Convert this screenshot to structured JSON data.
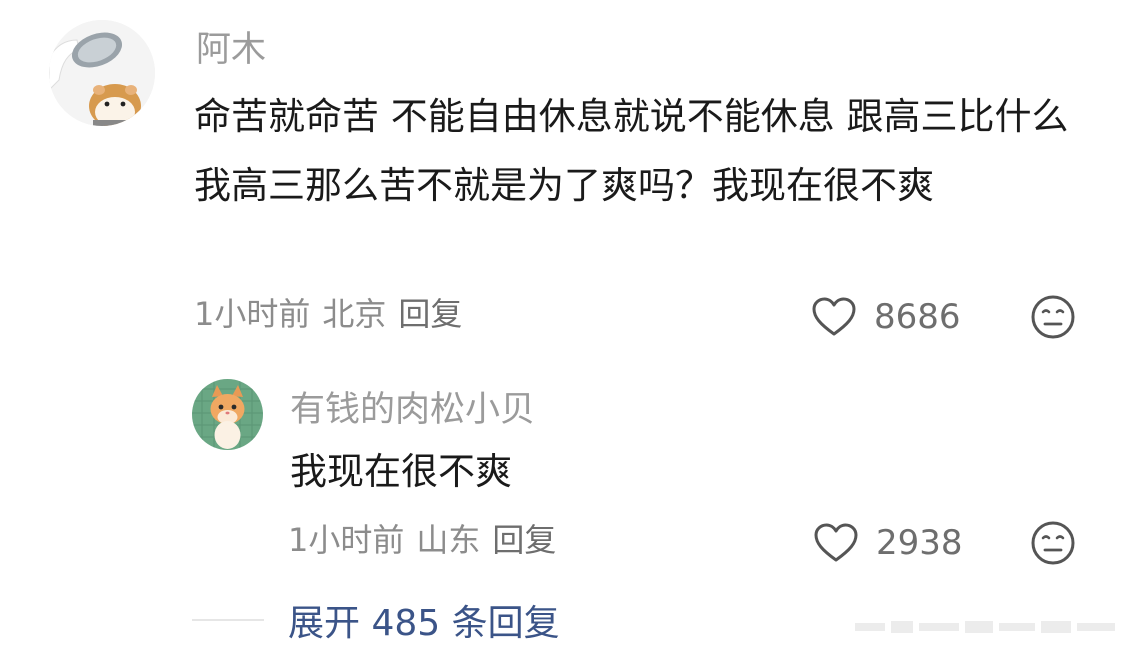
{
  "comment": {
    "author": "阿木",
    "text": "命苦就命苦 不能自由休息就说不能休息 跟高三比什么 我高三那么苦不就是为了爽吗？我现在很不爽",
    "time": "1小时前",
    "location": "北京",
    "reply_label": "回复",
    "likes": "8686",
    "avatar_icon": "hamster-avatar",
    "like_icon": "heart-outline-icon",
    "react_icon": "expressionless-face-icon"
  },
  "reply": {
    "author": "有钱的肉松小贝",
    "text": "我现在很不爽",
    "time": "1小时前",
    "location": "山东",
    "reply_label": "回复",
    "likes": "2938",
    "avatar_icon": "kitten-avatar",
    "like_icon": "heart-outline-icon",
    "react_icon": "expressionless-face-icon"
  },
  "expand_replies": "展开 485 条回复",
  "colors": {
    "text": "#1a1a1a",
    "author": "#9b9b9b",
    "meta": "#8c8c8c",
    "link": "#3b5488"
  }
}
